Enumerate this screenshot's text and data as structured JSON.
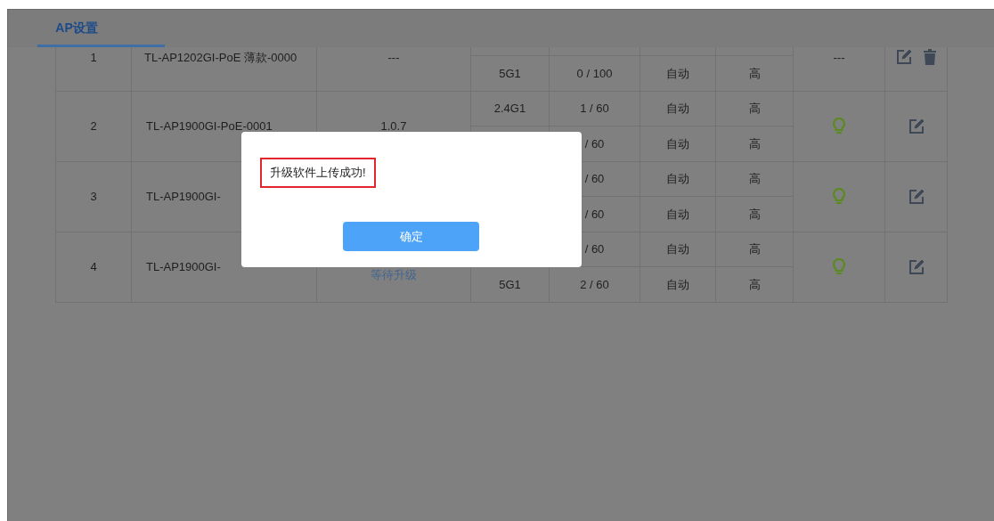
{
  "tab": {
    "label": "AP设置",
    "selected": true
  },
  "aps": [
    {
      "index": "1",
      "name": "TL-AP1202GI-PoE 薄款-0000",
      "version": "---",
      "radios": [
        {
          "band": "5G1",
          "clients": "0 / 100",
          "mode": "自动",
          "power": "高"
        }
      ],
      "status": {
        "kind": "text",
        "text": "---"
      },
      "deletable": true
    },
    {
      "index": "2",
      "name": "TL-AP1900GI-PoE-0001",
      "version": "1.0.7",
      "radios": [
        {
          "band": "2.4G1",
          "clients": "1 / 60",
          "mode": "自动",
          "power": "高"
        },
        {
          "clients": "/ 60",
          "mode": "自动",
          "power": "高"
        }
      ],
      "status": {
        "kind": "bulb"
      },
      "deletable": false
    },
    {
      "index": "3",
      "name": "TL-AP1900GI-",
      "radios": [
        {
          "clients": "/ 60",
          "mode": "自动",
          "power": "高"
        },
        {
          "clients": "/ 60",
          "mode": "自动",
          "power": "高"
        }
      ],
      "status": {
        "kind": "bulb"
      },
      "deletable": false
    },
    {
      "index": "4",
      "name": "TL-AP1900GI-",
      "upgrade_link": "等待升级",
      "radios": [
        {
          "clients": "/ 60",
          "mode": "自动",
          "power": "高"
        },
        {
          "band": "5G1",
          "clients": "2 / 60",
          "mode": "自动",
          "power": "高"
        }
      ],
      "status": {
        "kind": "bulb"
      },
      "deletable": false
    }
  ],
  "dialog": {
    "message": "升级软件上传成功!",
    "button": "确定"
  }
}
